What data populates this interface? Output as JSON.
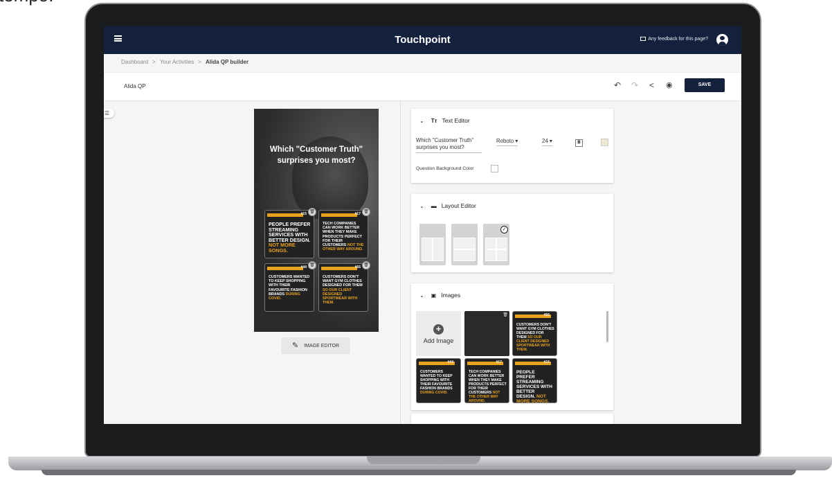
{
  "cut_caption": "tempo.",
  "app": {
    "title": "Touchpoint",
    "feedback": "Any feedback for this page?"
  },
  "breadcrumb": {
    "items": [
      "Dashboard",
      "Your Activities",
      "Alida QP builder"
    ],
    "separator": ">"
  },
  "toolbar": {
    "doc_name": "Alida QP",
    "save_label": "SAVE"
  },
  "preview": {
    "question": "Which \"Customer Truth\" surprises you most?",
    "image_editor_label": "IMAGE EDITOR",
    "cards": [
      {
        "num": "#15",
        "text": "PEOPLE PREFER STREAMING SERVICES WITH BETTER DESIGN.",
        "highlight": "NOT MORE SONGS."
      },
      {
        "num": "#17",
        "text": "TECH COMPANIES CAN WORK BETTER WHEN THEY MAKE PRODUCTS PERFECT FOR THEIR CUSTOMERS",
        "highlight": "NOT THE OTHER WAY AROUND."
      },
      {
        "num": "#44",
        "text": "CUSTOMERS WANTED TO KEEP SHOPPING WITH THEIR FAVOURITE FASHION BRANDS",
        "highlight": "DURING COVID."
      },
      {
        "num": "#56",
        "text": "CUSTOMERS DON'T WANT GYM CLOTHES DESIGNED FOR THEM",
        "highlight": "SO OUR CLIENT DESIGNED SPORTWEAR WITH THEM."
      }
    ]
  },
  "text_editor": {
    "title": "Text Editor",
    "question_value": "Which \"Customer Truth\" surprises you most?",
    "font": "Roboto",
    "size": "24",
    "bold": "B",
    "bg_color_label": "Question Background Color"
  },
  "layout_editor": {
    "title": "Layout Editor"
  },
  "images": {
    "title": "Images",
    "add_label": "Add Image",
    "thumbs": [
      {
        "num": "#56",
        "text": "CUSTOMERS DON'T WANT GYM CLOTHES DESIGNED FOR THEM",
        "highlight": "SO OUR CLIENT DESIGNED SPORTWEAR WITH THEM."
      },
      {
        "num": "#44",
        "text": "CUSTOMERS WANTED TO KEEP SHOPPING WITH THEIR FAVOURITE FASHION BRANDS",
        "highlight": "DURING COVID."
      },
      {
        "num": "#17",
        "text": "TECH COMPANIES CAN WORK BETTER WHEN THEY MAKE PRODUCTS PERFECT FOR THEIR CUSTOMERS",
        "highlight": "NOT THE OTHER WAY AROUND."
      },
      {
        "num": "#15",
        "text": "PEOPLE PREFER STREAMING SERVICES WITH BETTER DESIGN.",
        "highlight": "NOT MORE SONGS."
      }
    ]
  },
  "colors": {
    "navy": "#14213d",
    "accent": "#e8a21c"
  }
}
